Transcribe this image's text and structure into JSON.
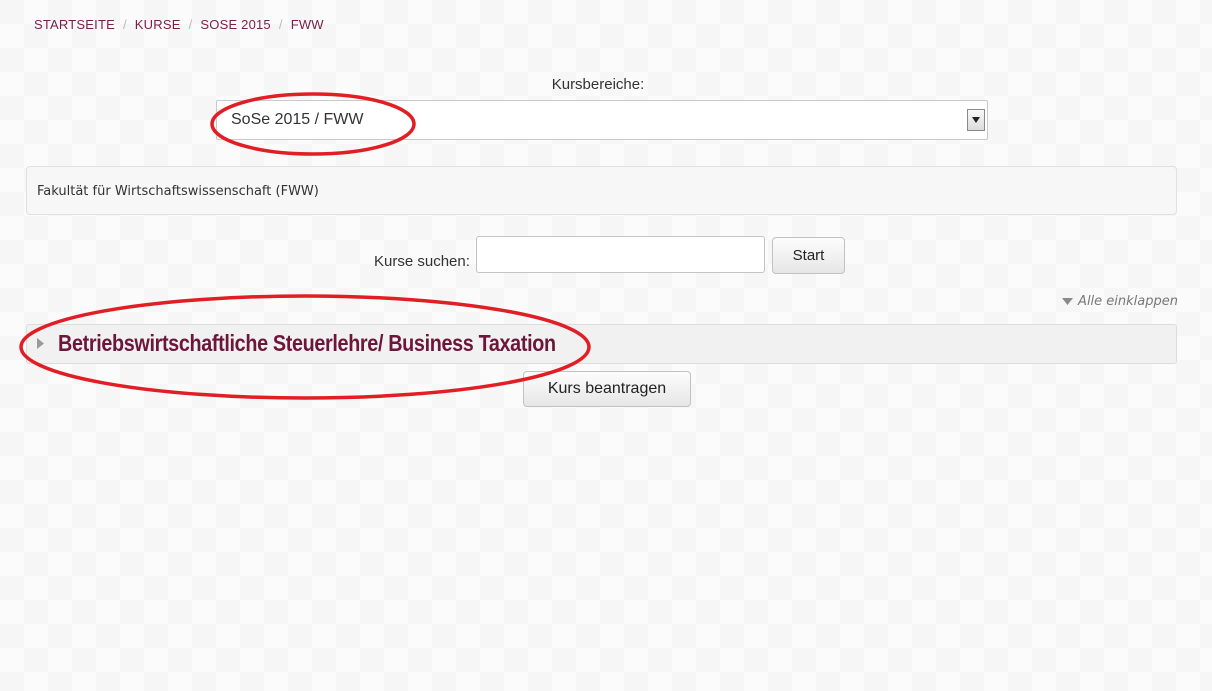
{
  "breadcrumb": {
    "items": [
      "STARTSEITE",
      "KURSE",
      "SOSE 2015",
      "FWW"
    ],
    "separator": "/"
  },
  "category_selector": {
    "label": "Kursbereiche:",
    "selected": "SoSe 2015 / FWW"
  },
  "category_description": "Fakultät für Wirtschaftswissenschaft (FWW)",
  "search": {
    "label": "Kurse suchen:",
    "value": "",
    "button": "Start"
  },
  "collapse_all": "Alle einklappen",
  "course_category": {
    "name": "Betriebswirtschaftliche Steuerlehre/ Business Taxation"
  },
  "request_course_button": "Kurs beantragen",
  "colors": {
    "link": "#7a1f45",
    "category_title": "#6d1639",
    "annotation": "#e01e24"
  },
  "icons": {
    "select_arrow": "triangle-down-icon",
    "collapse": "triangle-down-icon",
    "expand": "triangle-right-icon"
  }
}
